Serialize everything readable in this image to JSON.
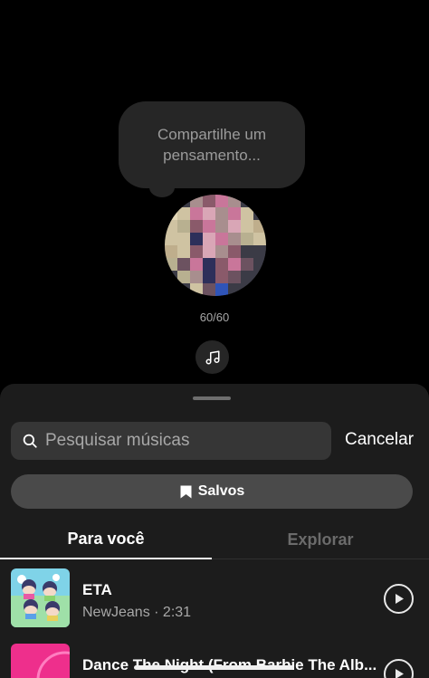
{
  "composer": {
    "placeholder": "Compartilhe um pensamento...",
    "counter": "60/60",
    "music_icon": "music-note-icon"
  },
  "sheet": {
    "search": {
      "placeholder": "Pesquisar músicas",
      "value": "",
      "icon": "search-icon"
    },
    "cancel_label": "Cancelar",
    "saved": {
      "label": "Salvos",
      "icon": "bookmark-icon"
    },
    "tabs": [
      {
        "label": "Para você",
        "active": true
      },
      {
        "label": "Explorar",
        "active": false
      }
    ],
    "songs": [
      {
        "title": "ETA",
        "subtitle": "NewJeans · 2:31",
        "icon": "play-icon"
      },
      {
        "title": "Dance The Night (From Barbie The Alb...",
        "subtitle": "",
        "icon": "play-icon"
      }
    ]
  },
  "colors": {
    "background": "#000000",
    "sheet": "#1c1c1c",
    "search_field": "#363636",
    "saved_button": "#4a4a4a",
    "muted_text": "#a8a8a8"
  }
}
